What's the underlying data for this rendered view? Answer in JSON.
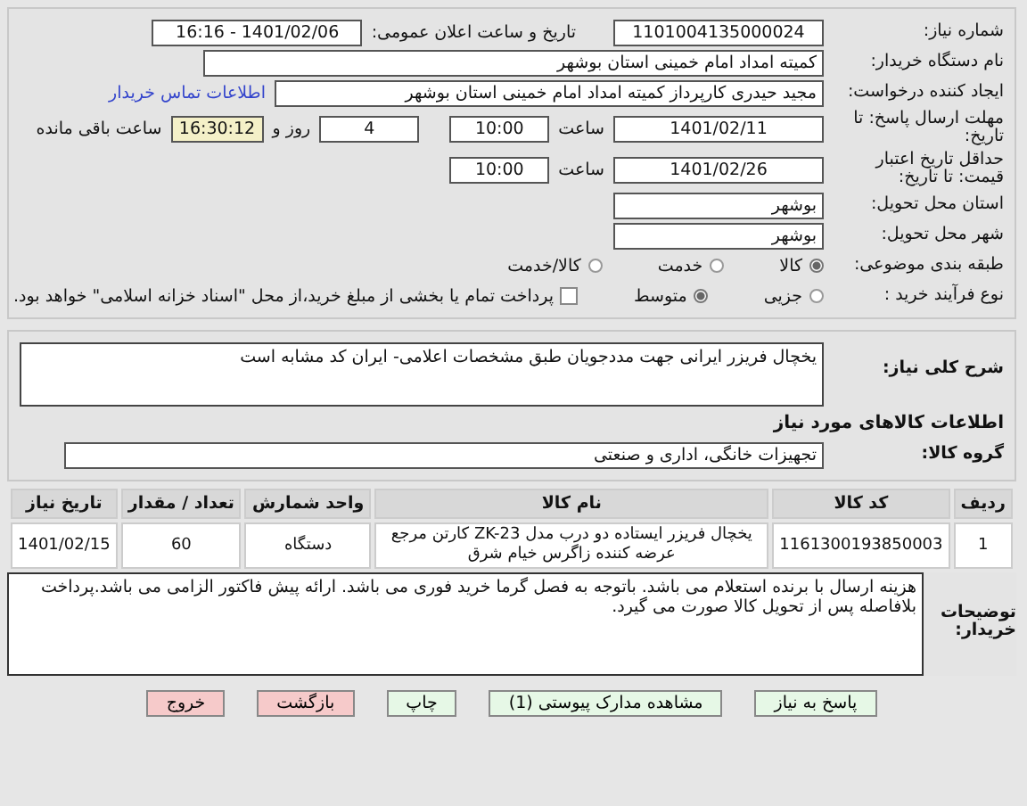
{
  "need_number": {
    "label": "شماره نیاز:",
    "value": "1101004135000024"
  },
  "announce": {
    "label": "تاریخ و ساعت اعلان عمومی:",
    "value": "1401/02/06 - 16:16"
  },
  "buyer_org": {
    "label": "نام دستگاه خریدار:",
    "value": "کمیته امداد امام خمینی استان بوشهر"
  },
  "requester": {
    "label": "ایجاد کننده درخواست:",
    "value": "مجید حیدری کارپرداز کمیته امداد امام خمینی استان بوشهر",
    "link": "اطلاعات تماس خریدار"
  },
  "deadline": {
    "label": "مهلت ارسال پاسخ: تا تاریخ:",
    "date": "1401/02/11",
    "time_label": "ساعت",
    "time": "10:00",
    "days": "4",
    "days_label": "روز و",
    "remaining": "16:30:12",
    "remaining_label": "ساعت باقی مانده"
  },
  "validity": {
    "label": "حداقل تاریخ اعتبار قیمت: تا تاریخ:",
    "date": "1401/02/26",
    "time_label": "ساعت",
    "time": "10:00"
  },
  "province": {
    "label": "استان محل تحویل:",
    "value": "بوشهر"
  },
  "city": {
    "label": "شهر محل تحویل:",
    "value": "بوشهر"
  },
  "category": {
    "label": "طبقه بندی موضوعی:",
    "options": [
      {
        "label": "کالا",
        "selected": true
      },
      {
        "label": "خدمت",
        "selected": false
      },
      {
        "label": "کالا/خدمت",
        "selected": false
      }
    ]
  },
  "process": {
    "label": "نوع فرآیند خرید :",
    "options": [
      {
        "label": "جزیی",
        "selected": false
      },
      {
        "label": "متوسط",
        "selected": true
      }
    ],
    "treasury": {
      "checked": false,
      "label": "پرداخت تمام یا بخشی از مبلغ خرید،از محل \"اسناد خزانه اسلامی\" خواهد بود."
    }
  },
  "description": {
    "label": "شرح کلی نیاز:",
    "value": "یخچال فریزر ایرانی جهت مددجویان طبق مشخصات اعلامی- ایران کد مشابه است"
  },
  "goods_title": "اطلاعات کالاهای مورد نیاز",
  "goods_group": {
    "label": "گروه کالا:",
    "value": "تجهیزات خانگی، اداری و صنعتی"
  },
  "table": {
    "columns": [
      "ردیف",
      "کد کالا",
      "نام کالا",
      "واحد شمارش",
      "تعداد / مقدار",
      "تاریخ نیاز"
    ],
    "rows": [
      [
        "1",
        "1161300193850003",
        "یخچال فریزر ایستاده دو درب مدل ZK-23 کارتن مرجع عرضه کننده زاگرس خیام شرق",
        "دستگاه",
        "60",
        "1401/02/15"
      ]
    ]
  },
  "notes": {
    "label": "توضیحات خریدار:",
    "value": "هزینه ارسال با برنده استعلام می باشد. باتوجه به فصل گرما خرید فوری می باشد. ارائه پیش فاکتور الزامی می باشد.پرداخت بلافاصله پس از تحویل کالا صورت می گیرد."
  },
  "buttons": [
    {
      "label": "پاسخ به نیاز",
      "kind": "action"
    },
    {
      "label": "مشاهده مدارک پیوستی (1)",
      "kind": "action"
    },
    {
      "label": "چاپ",
      "kind": "action"
    },
    {
      "label": "بازگشت",
      "kind": "exit"
    },
    {
      "label": "خروج",
      "kind": "exit"
    }
  ]
}
